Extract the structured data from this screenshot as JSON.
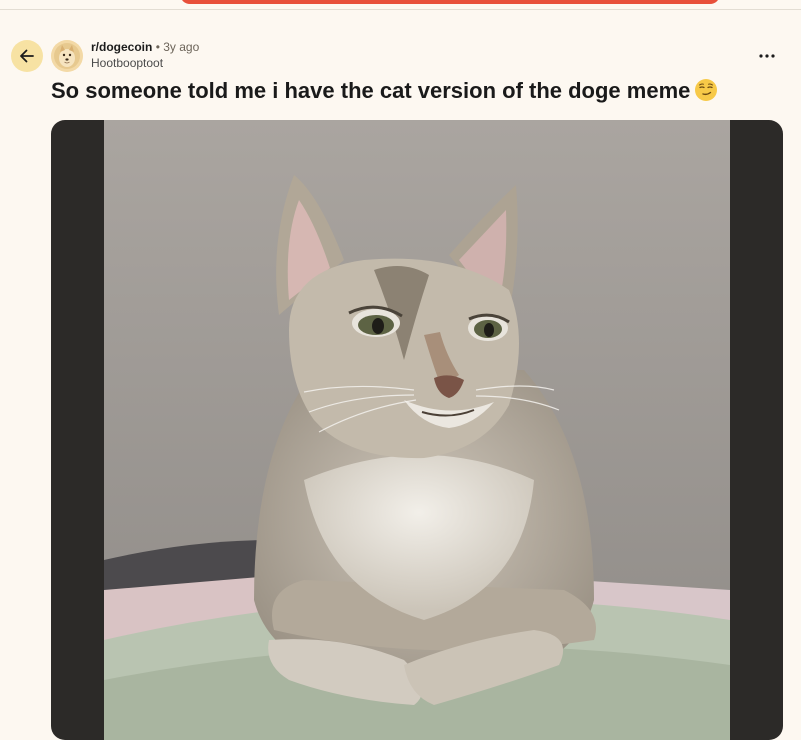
{
  "post": {
    "subreddit": "r/dogecoin",
    "separator": "•",
    "age": "3y ago",
    "author": "Hootbooptoot",
    "title": "So someone told me i have the cat version of the doge meme"
  },
  "icons": {
    "back": "arrow-left-icon",
    "more": "more-horizontal-icon",
    "emoji": "smirking-face-emoji",
    "avatar": "doge-avatar"
  },
  "colors": {
    "page_background": "#fdf8f1",
    "back_button": "#f7e2a3",
    "top_accent": "#e8503a",
    "media_frame": "#2c2a28"
  }
}
